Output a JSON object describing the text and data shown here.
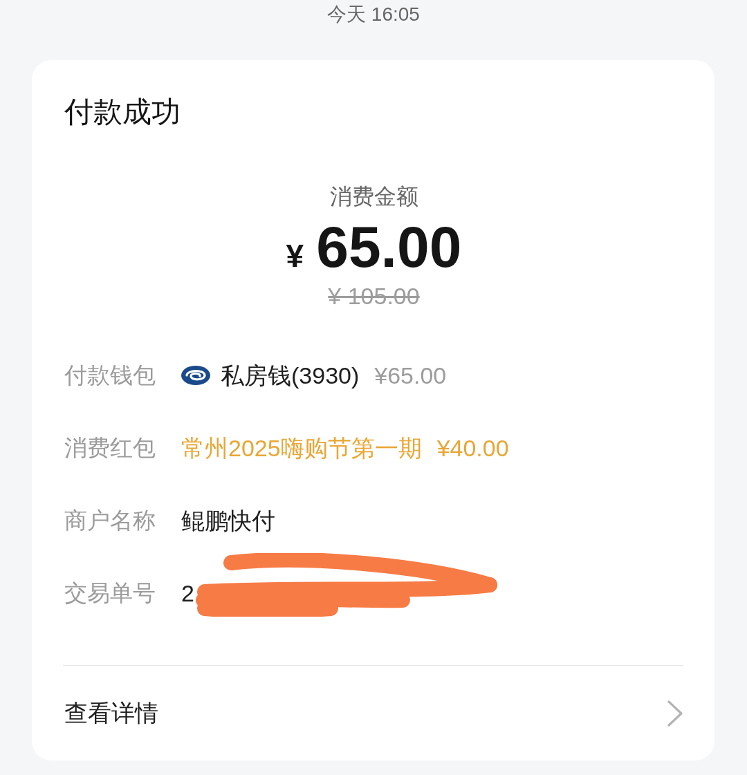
{
  "header": {
    "timestamp": "今天 16:05"
  },
  "card": {
    "title": "付款成功",
    "amount_label": "消费金额",
    "currency": "¥",
    "amount": "65.00",
    "original_amount": "¥ 105.00",
    "rows": [
      {
        "kind": "wallet",
        "label": "付款钱包",
        "value": "私房钱(3930)",
        "amount": "¥65.00"
      },
      {
        "kind": "coupon",
        "label": "消费红包",
        "value": "常州2025嗨购节第一期",
        "amount": "¥40.00"
      },
      {
        "kind": "text",
        "label": "商户名称",
        "value": "鲲鹏快付"
      },
      {
        "kind": "redacted",
        "label": "交易单号",
        "value": "2"
      }
    ],
    "details": {
      "label": "查看详情"
    }
  }
}
